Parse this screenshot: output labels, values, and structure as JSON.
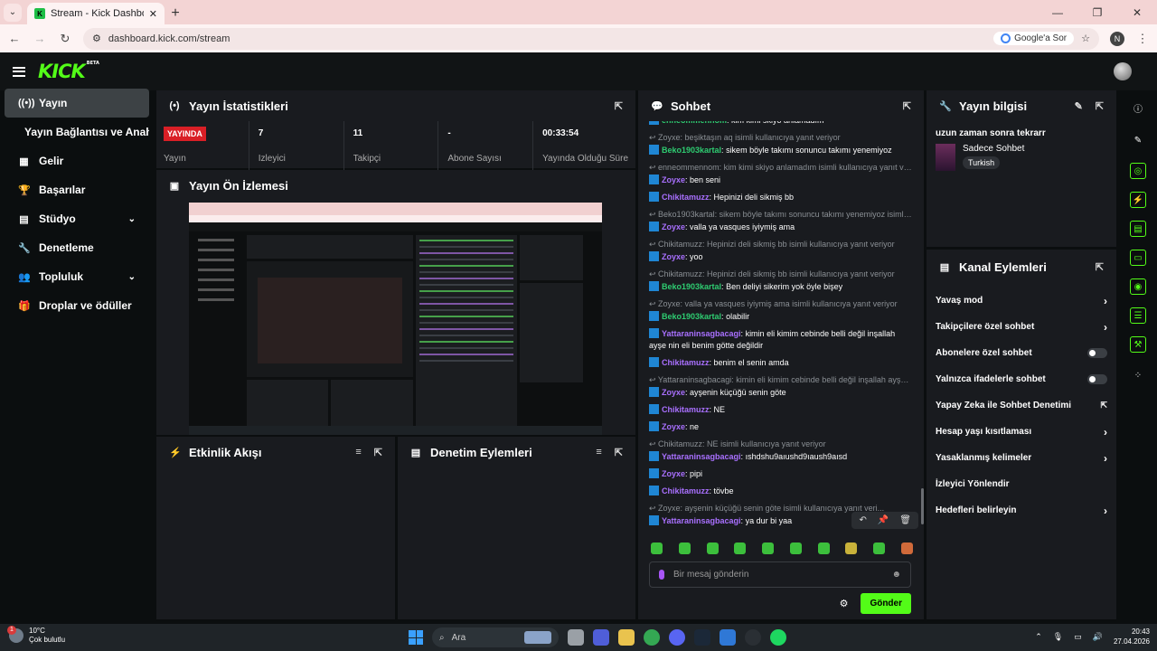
{
  "browser": {
    "tab_title": "Stream - Kick Dashboard",
    "url": "dashboard.kick.com/stream",
    "google_ask": "Google'a Sor",
    "profile_initial": "N"
  },
  "kick": {
    "logo": "KICK",
    "beta": "BETA"
  },
  "sidebar": {
    "items": [
      {
        "label": "Yayın",
        "icon": "broadcast-icon"
      },
      {
        "label": "Yayın Bağlantısı ve Anahtarı",
        "icon": ""
      },
      {
        "label": "Gelir",
        "icon": "chart-icon"
      },
      {
        "label": "Başarılar",
        "icon": "trophy-icon"
      },
      {
        "label": "Stüdyo",
        "icon": "studio-icon"
      },
      {
        "label": "Denetleme",
        "icon": "wrench-icon"
      },
      {
        "label": "Topluluk",
        "icon": "people-icon"
      },
      {
        "label": "Droplar ve ödüller",
        "icon": "gift-icon"
      }
    ]
  },
  "stats": {
    "title": "Yayın İstatistikleri",
    "live_badge": "YAYINDA",
    "items": [
      {
        "value": "",
        "label": "Yayın"
      },
      {
        "value": "7",
        "label": "İzleyici"
      },
      {
        "value": "11",
        "label": "Takipçi"
      },
      {
        "value": "-",
        "label": "Abone Sayısı"
      },
      {
        "value": "00:33:54",
        "label": "Yayında Olduğu Süre"
      }
    ]
  },
  "preview": {
    "title": "Yayın Ön İzlemesi"
  },
  "activity": {
    "title": "Etkinlik Akışı"
  },
  "moderation": {
    "title": "Denetim Eylemleri"
  },
  "chat": {
    "title": "Sohbet",
    "placeholder": "Bir mesaj gönderin",
    "send": "Gönder",
    "messages": [
      {
        "reply": "",
        "user": "enneommennom",
        "color": "#2ecc71",
        "text": "kim kimi skiyo anlamadım"
      },
      {
        "reply": "Zoyxe: beşiktaşın aq isimli kullanıcıya yanıt veriyor",
        "user": "Beko1903kartal",
        "color": "#2ecc71",
        "text": "sikem böyle takımı sonuncu takımı yenemiyoz"
      },
      {
        "reply": "enneommennom: kim kimi skiyo anlamadım isimli kullanıcıya yanıt veri...",
        "user": "Zoyxe",
        "color": "#a970ff",
        "text": "ben seni"
      },
      {
        "reply": "",
        "user": "Chikitamuzz",
        "color": "#a970ff",
        "text": "Hepinizi deli sikmiş bb"
      },
      {
        "reply": "Beko1903kartal: sikem böyle takımı sonuncu takımı yenemiyoz isimli k...",
        "user": "Zoyxe",
        "color": "#a970ff",
        "text": "valla ya vasques iyiymiş ama"
      },
      {
        "reply": "Chikitamuzz: Hepinizi deli sikmiş bb isimli kullanıcıya yanıt veriyor",
        "user": "Zoyxe",
        "color": "#a970ff",
        "text": "yoo"
      },
      {
        "reply": "Chikitamuzz: Hepinizi deli sikmiş bb isimli kullanıcıya yanıt veriyor",
        "user": "Beko1903kartal",
        "color": "#2ecc71",
        "text": "Ben deliyi sikerim yok öyle bişey"
      },
      {
        "reply": "Zoyxe: valla ya vasques iyiymiş ama isimli kullanıcıya yanıt veriyor",
        "user": "Beko1903kartal",
        "color": "#2ecc71",
        "text": "olabilir"
      },
      {
        "reply": "",
        "user": "Yattaraninsagbacagi",
        "color": "#a970ff",
        "text": "kimin eli kimim cebinde belli değil inşallah ayşe nin eli benim götte değildir"
      },
      {
        "reply": "",
        "user": "Chikitamuzz",
        "color": "#a970ff",
        "text": "benim el senin amda"
      },
      {
        "reply": "Yattaraninsagbacagi: kimin eli kimim cebinde belli değil inşallah ayşe n...",
        "user": "Zoyxe",
        "color": "#a970ff",
        "text": "ayşenin küçüğü senin göte"
      },
      {
        "reply": "",
        "user": "Chikitamuzz",
        "color": "#a970ff",
        "text": "NE"
      },
      {
        "reply": "",
        "user": "Zoyxe",
        "color": "#a970ff",
        "text": "ne"
      },
      {
        "reply": "Chikitamuzz: NE isimli kullanıcıya yanıt veriyor",
        "user": "Yattaraninsagbacagi",
        "color": "#a970ff",
        "text": "ıshdshu9aıushd9ıaush9aısd"
      },
      {
        "reply": "",
        "user": "Zoyxe",
        "color": "#a970ff",
        "text": "pipi"
      },
      {
        "reply": "",
        "user": "Chikitamuzz",
        "color": "#a970ff",
        "text": "tövbe"
      },
      {
        "reply": "Zoyxe: ayşenin küçüğü senin göte isimli kullanıcıya yanıt veri...",
        "user": "Yattaraninsagbacagi",
        "color": "#a970ff",
        "text": "ya dur bi yaa"
      }
    ]
  },
  "stream_info": {
    "title": "Yayın bilgisi",
    "stream_title": "uzun zaman sonra tekrarr",
    "category": "Sadece Sohbet",
    "language": "Turkish"
  },
  "channel_actions": {
    "title": "Kanal Eylemleri",
    "items": [
      {
        "label": "Yavaş mod",
        "type": "chevron"
      },
      {
        "label": "Takipçilere özel sohbet",
        "type": "chevron"
      },
      {
        "label": "Abonelere özel sohbet",
        "type": "toggle"
      },
      {
        "label": "Yalnızca ifadelerle sohbet",
        "type": "toggle"
      },
      {
        "label": "Yapay Zeka ile Sohbet Denetimi",
        "type": "external"
      },
      {
        "label": "Hesap yaşı kısıtlaması",
        "type": "chevron"
      },
      {
        "label": "Yasaklanmış kelimeler",
        "type": "chevron"
      },
      {
        "label": "İzleyici Yönlendir",
        "type": "none"
      },
      {
        "label": "Hedefleri belirleyin",
        "type": "chevron"
      }
    ]
  },
  "taskbar": {
    "temp": "10°C",
    "weather": "Çok bulutlu",
    "weather_badge": "1",
    "search": "Ara",
    "time": "20:43",
    "date": "27.04.2026"
  }
}
